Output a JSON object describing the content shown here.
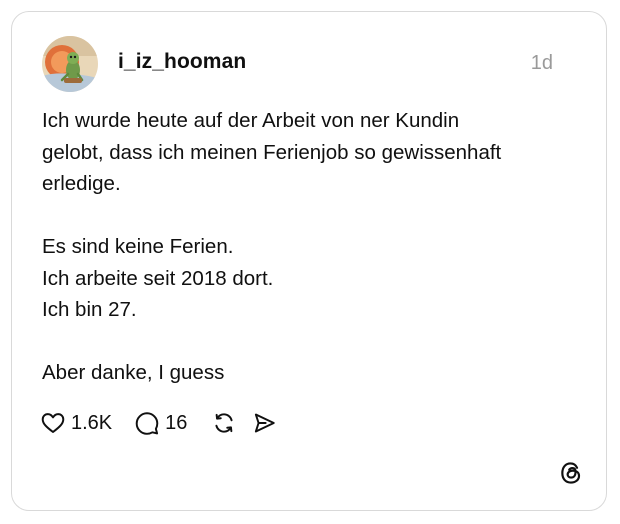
{
  "post": {
    "username": "i_iz_hooman",
    "timestamp": "1d",
    "paragraphs": [
      [
        "Ich wurde heute auf der Arbeit von ner Kundin",
        "gelobt, dass ich meinen Ferienjob so gewissenhaft",
        "erledige."
      ],
      [
        "Es sind keine Ferien.",
        "Ich arbeite seit 2018 dort.",
        "Ich bin 27."
      ],
      [
        "Aber danke, I guess"
      ]
    ],
    "avatar_icon": "frog-avatar-icon"
  },
  "actions": {
    "likes": "1.6K",
    "replies": "16",
    "icons": [
      "heart-icon",
      "comment-icon",
      "repost-icon",
      "share-icon"
    ]
  },
  "brand": {
    "logo_icon": "threads-logo-icon",
    "colors": {
      "text": "#101010",
      "muted": "#9a9a9a",
      "border": "#d9d9d9"
    }
  }
}
